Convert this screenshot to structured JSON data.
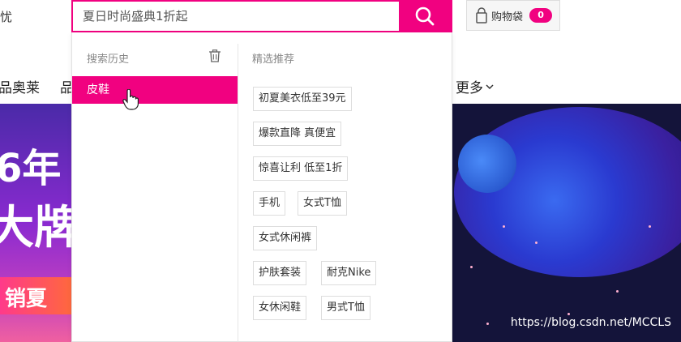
{
  "header": {
    "left_snippet": "忧",
    "search": {
      "placeholder": "夏日时尚盛典1折起"
    },
    "cart": {
      "label": "购物袋",
      "count": "0"
    }
  },
  "nav": {
    "items": [
      "品奥莱",
      "品"
    ],
    "more_label": "更多"
  },
  "dropdown": {
    "history_title": "搜索历史",
    "history_items": [
      "皮鞋"
    ],
    "recommend_title": "精选推荐",
    "recommend_tags": [
      "初夏美衣低至39元",
      "爆款直降 真便宜",
      "惊喜让利 低至1折",
      "手机",
      "女式T恤",
      "女式休闲裤",
      "护肤套装",
      "耐克Nike",
      "女休闲鞋",
      "男式T恤"
    ]
  },
  "banner": {
    "text1": "6年",
    "text2": "大牌",
    "text3": "销夏"
  },
  "watermark": "https://blog.csdn.net/MCCLS",
  "colors": {
    "accent": "#f10180"
  }
}
